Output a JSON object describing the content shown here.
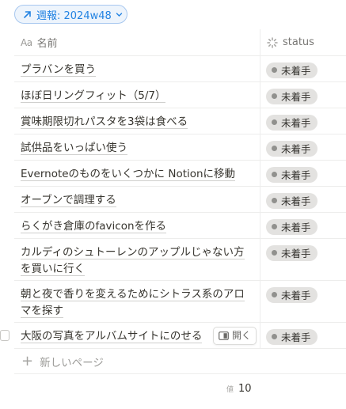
{
  "view": {
    "label": "週報: 2024w48"
  },
  "columns": {
    "name": "名前",
    "name_icon": "Aa",
    "status": "status"
  },
  "rows": [
    {
      "name": "プラバンを買う",
      "status": "未着手"
    },
    {
      "name": "ほぼ日リングフィット（5/7）",
      "status": "未着手"
    },
    {
      "name": "賞味期限切れパスタを3袋は食べる",
      "status": "未着手"
    },
    {
      "name": "試供品をいっぱい使う",
      "status": "未着手"
    },
    {
      "name": "Evernoteのものをいくつかに Notionに移動",
      "status": "未着手"
    },
    {
      "name": "オーブンで調理する",
      "status": "未着手"
    },
    {
      "name": "らくがき倉庫のfaviconを作る",
      "status": "未着手"
    },
    {
      "name": "カルディのシュトーレンのアップルじゃない方を買いに行く",
      "status": "未着手"
    },
    {
      "name": "朝と夜で香りを変えるためにシトラス系のアロマを探す",
      "status": "未着手"
    },
    {
      "name": "大阪の写真をアルバムサイトにのせる",
      "status": "未着手"
    }
  ],
  "open_button": {
    "label": "開く"
  },
  "new_page": {
    "label": "新しいページ"
  },
  "footer": {
    "label": "値",
    "count": "10"
  },
  "colors": {
    "accent": "#2383e2",
    "badge_bg": "#e3e2e0"
  }
}
